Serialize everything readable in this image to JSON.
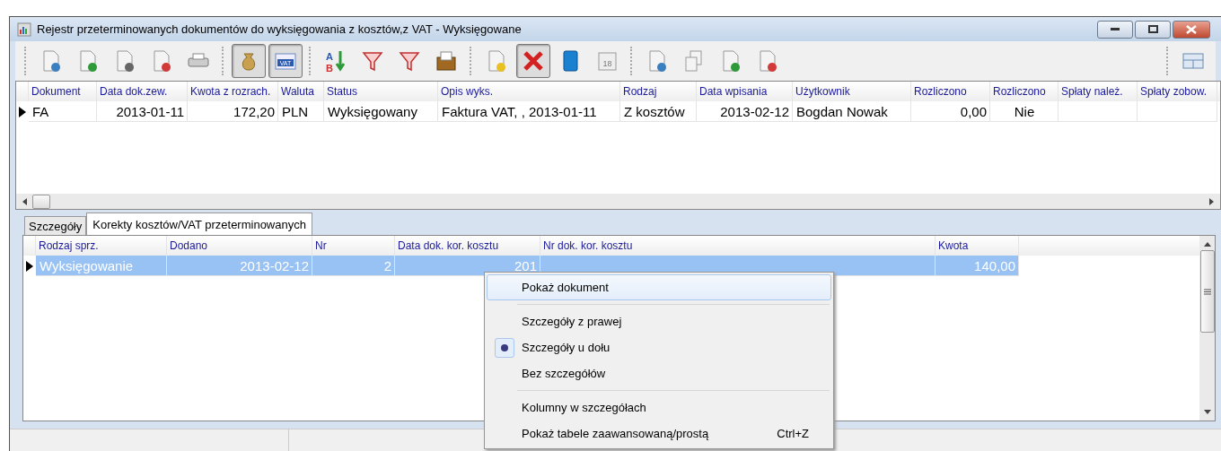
{
  "window": {
    "title": "Rejestr przeterminowanych dokumentów do wyksięgowania z kosztów,z VAT - Wyksięgowane"
  },
  "toolbar": [
    {
      "kind": "doc-search",
      "pressed": false
    },
    {
      "kind": "doc-add",
      "pressed": false
    },
    {
      "kind": "doc-edit",
      "pressed": false
    },
    {
      "kind": "doc-delete",
      "pressed": false
    },
    {
      "kind": "printer",
      "pressed": false
    },
    {
      "kind": "sep"
    },
    {
      "kind": "money-bag",
      "pressed": true
    },
    {
      "kind": "vat",
      "pressed": true,
      "label": "VAT"
    },
    {
      "kind": "sep"
    },
    {
      "kind": "sort",
      "pressed": false,
      "label": "AB"
    },
    {
      "kind": "filter-edit",
      "pressed": false
    },
    {
      "kind": "filter",
      "pressed": false
    },
    {
      "kind": "box",
      "pressed": false
    },
    {
      "kind": "sep"
    },
    {
      "kind": "doc-star",
      "pressed": false
    },
    {
      "kind": "delete",
      "pressed": true
    },
    {
      "kind": "book",
      "pressed": false
    },
    {
      "kind": "calendar",
      "pressed": false,
      "label": "18"
    },
    {
      "kind": "sep"
    },
    {
      "kind": "pen-doc",
      "pressed": false
    },
    {
      "kind": "docs",
      "pressed": false
    },
    {
      "kind": "doc-green",
      "pressed": false
    },
    {
      "kind": "doc-red",
      "pressed": false
    }
  ],
  "main_table": {
    "columns": [
      "Dokument",
      "Data dok.zew.",
      "Kwota z rozrach.",
      "Waluta",
      "Status",
      "Opis wyks.",
      "Rodzaj",
      "Data wpisania",
      "Użytkownik",
      "Rozliczono",
      "Rozliczono",
      "Spłaty należ.",
      "Spłaty zobow."
    ],
    "rows": [
      {
        "selected": false,
        "cells": [
          "FA",
          "2013-01-11",
          "172,20",
          "PLN",
          "Wyksięgowany",
          "Faktura VAT, , 2013-01-11",
          "Z kosztów",
          "2013-02-12",
          "Bogdan Nowak",
          "0,00",
          "Nie",
          "",
          ""
        ]
      }
    ]
  },
  "tabs": [
    {
      "label": "Szczegóły",
      "selected": false
    },
    {
      "label": "Korekty kosztów/VAT przeterminowanych",
      "selected": true
    }
  ],
  "detail_table": {
    "columns": [
      "Rodzaj sprz.",
      "Dodano",
      "Nr",
      "Data dok. kor. kosztu",
      "Nr dok. kor. kosztu",
      "Kwota"
    ],
    "rows": [
      {
        "selected": true,
        "cells": [
          "Wyksięgowanie",
          "2013-02-12",
          "2",
          "201",
          "",
          "140,00"
        ]
      }
    ]
  },
  "context_menu": [
    {
      "kind": "item",
      "label": "Pokaż dokument",
      "hovered": true,
      "selected": false
    },
    {
      "kind": "separator"
    },
    {
      "kind": "item",
      "label": "Szczegóły z prawej",
      "hovered": false,
      "selected": false
    },
    {
      "kind": "item",
      "label": "Szczegóły u dołu",
      "hovered": false,
      "selected": true
    },
    {
      "kind": "item",
      "label": "Bez szczegółów",
      "hovered": false,
      "selected": false
    },
    {
      "kind": "separator"
    },
    {
      "kind": "item",
      "label": "Kolumny w szczegółach",
      "hovered": false,
      "selected": false
    },
    {
      "kind": "item",
      "label": "Pokaż tabele zaawansowaną/prostą",
      "shortcut": "Ctrl+Z",
      "hovered": false,
      "selected": false
    }
  ]
}
